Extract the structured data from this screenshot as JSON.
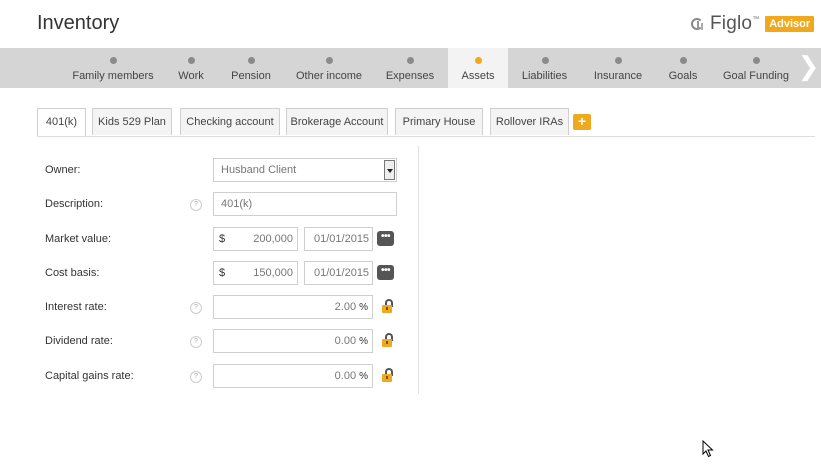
{
  "header": {
    "title": "Inventory",
    "brand": "Figlo",
    "brand_tm": "™",
    "badge": "Advisor"
  },
  "nav": {
    "items": [
      {
        "label": "Family members"
      },
      {
        "label": "Work"
      },
      {
        "label": "Pension"
      },
      {
        "label": "Other income"
      },
      {
        "label": "Expenses"
      },
      {
        "label": "Assets"
      },
      {
        "label": "Liabilities"
      },
      {
        "label": "Insurance"
      },
      {
        "label": "Goals"
      },
      {
        "label": "Goal Funding"
      }
    ],
    "active": "Assets",
    "next_icon": "chevron-right-icon",
    "next_glyph": "❯"
  },
  "tabs": {
    "items": [
      "401(k)",
      "Kids 529 Plan",
      "Checking account",
      "Brokerage Account",
      "Primary House",
      "Rollover IRAs"
    ],
    "active": "401(k)",
    "add_label": "+"
  },
  "form": {
    "owner": {
      "label": "Owner:",
      "value": "Husband Client"
    },
    "description": {
      "label": "Description:",
      "help": "?",
      "value": "401(k)"
    },
    "market_value": {
      "label": "Market value:",
      "currency": "$",
      "value": "200,000",
      "date": "01/01/2015",
      "more": "•••"
    },
    "cost_basis": {
      "label": "Cost basis:",
      "currency": "$",
      "value": "150,000",
      "date": "01/01/2015",
      "more": "•••"
    },
    "interest_rate": {
      "label": "Interest rate:",
      "help": "?",
      "value": "2.00",
      "unit": "%"
    },
    "dividend_rate": {
      "label": "Dividend rate:",
      "help": "?",
      "value": "0.00",
      "unit": "%"
    },
    "capital_gains_rate": {
      "label": "Capital gains rate:",
      "help": "?",
      "value": "0.00",
      "unit": "%"
    }
  },
  "colors": {
    "accent": "#f0a81c",
    "nav_bg": "#d6d5d5",
    "nav_active_bg": "#f3f3f3"
  }
}
